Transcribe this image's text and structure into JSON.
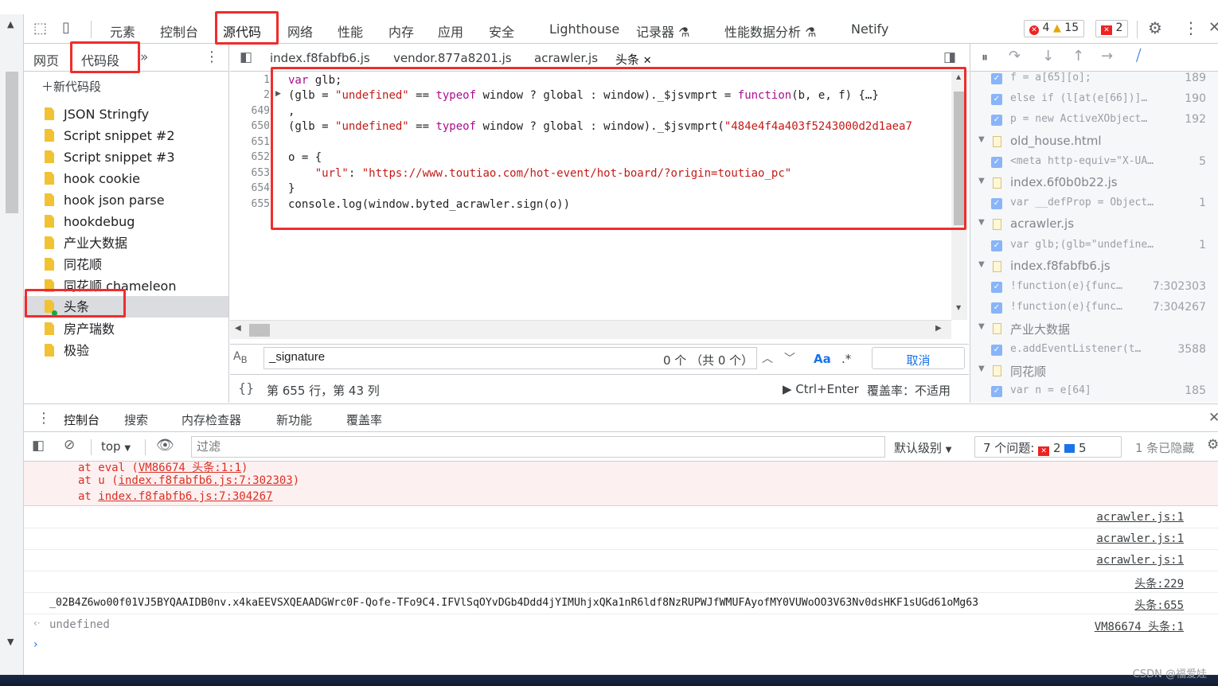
{
  "toolbar": {
    "tabs": [
      "元素",
      "控制台",
      "源代码",
      "网络",
      "性能",
      "内存",
      "应用",
      "安全",
      "Lighthouse",
      "记录器",
      "性能数据分析",
      "Netify"
    ],
    "errors": "4",
    "warnings": "15",
    "issues": "2"
  },
  "navigator": {
    "tabs": [
      "网页",
      "代码段"
    ],
    "new_snippet": "新代码段",
    "snippets": [
      "JSON Stringfy",
      "Script snippet #2",
      "Script snippet #3",
      "hook cookie",
      "hook json parse",
      "hookdebug",
      "产业大数据",
      "同花顺",
      "同花顺 chameleon",
      "头条",
      "房产瑞数",
      "极验"
    ]
  },
  "editor": {
    "tabs": [
      "index.f8fabfb6.js",
      "vendor.877a8201.js",
      "acrawler.js",
      "头条"
    ],
    "line_numbers": [
      "1",
      "2",
      "649",
      "650",
      "651",
      "652",
      "653",
      "654",
      "655"
    ]
  },
  "search": {
    "value": "_signature",
    "count": "0 个 （共 0 个）",
    "case_label": "Aa",
    "regex_label": ".*",
    "cancel": "取消"
  },
  "status": {
    "position": "第 655 行，第 43 列",
    "run": "Ctrl+Enter",
    "coverage": "覆盖率：不适用"
  },
  "breakpoints": {
    "rows": [
      {
        "kind": "bp",
        "text": "f = a[65][o];",
        "line": "189"
      },
      {
        "kind": "bp",
        "text": "else if (l[at(e[66])]…",
        "line": "190"
      },
      {
        "kind": "bp",
        "text": "p = new ActiveXObject…",
        "line": "192"
      },
      {
        "kind": "file",
        "text": "old_house.html"
      },
      {
        "kind": "bp",
        "text": "<meta http-equiv=\"X-UA…",
        "line": "5"
      },
      {
        "kind": "file",
        "text": "index.6f0b0b22.js"
      },
      {
        "kind": "bp",
        "text": "var __defProp = Object…",
        "line": "1"
      },
      {
        "kind": "file",
        "text": "acrawler.js"
      },
      {
        "kind": "bp",
        "text": "var glb;(glb=\"undefine…",
        "line": "1"
      },
      {
        "kind": "file",
        "text": "index.f8fabfb6.js"
      },
      {
        "kind": "bp",
        "text": "!function(e){func…",
        "line": "7:302303"
      },
      {
        "kind": "bp",
        "text": "!function(e){func…",
        "line": "7:304267"
      },
      {
        "kind": "file",
        "text": "产业大数据"
      },
      {
        "kind": "bp",
        "text": "e.addEventListener(t…",
        "line": "3588"
      },
      {
        "kind": "file",
        "text": "同花顺"
      },
      {
        "kind": "bp",
        "text": "var n = e[64]",
        "line": "185"
      }
    ]
  },
  "drawer": {
    "tabs": [
      "控制台",
      "搜索",
      "内存检查器",
      "新功能",
      "覆盖率"
    ]
  },
  "console_toolbar": {
    "context": "top",
    "filter_placeholder": "过滤",
    "level": "默认级别",
    "issues_label": "7 个问题:",
    "issues_errors": "2",
    "issues_info": "5",
    "hidden": "1 条已隐藏"
  },
  "console": {
    "error_lines": [
      {
        "prefix": "at eval (",
        "link": "VM86674 头条:1:1",
        "suffix": ")"
      },
      {
        "prefix": "at u (",
        "link": "index.f8fabfb6.js:7:302303",
        "suffix": ")"
      },
      {
        "prefix": "at ",
        "link": "index.f8fabfb6.js:7:304267",
        "suffix": ""
      }
    ],
    "rows": [
      {
        "msg": "",
        "src": "acrawler.js:1"
      },
      {
        "msg": "",
        "src": "acrawler.js:1"
      },
      {
        "msg": "",
        "src": "acrawler.js:1"
      },
      {
        "msg": "",
        "src": "头条:229"
      },
      {
        "msg": "_02B4Z6wo00f01VJ5BYQAAIDB0nv.x4kaEEVSXQEAADGWrc0F-Qofe-TFo9C4.IFVlSqOYvDGb4Ddd4jYIMUhjxQKa1nR6ldf8NzRUPWJfWMUFAyofMY0VUWoOO3V63Nv0dsHKF1sUGd61oMg63",
        "src": "头条:655"
      },
      {
        "msg": "undefined",
        "src": "VM86674 头条:1"
      }
    ]
  },
  "watermark": "CSDN @福爱娃"
}
